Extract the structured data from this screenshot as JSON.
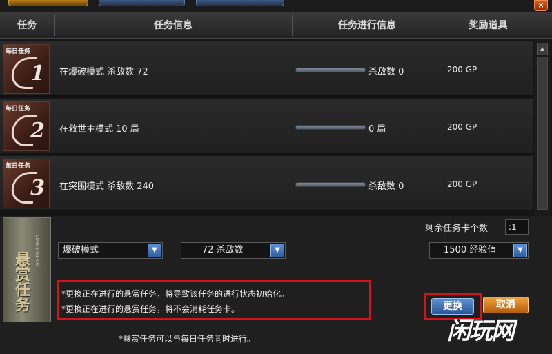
{
  "window": {
    "close_label": "×"
  },
  "header": {
    "col_task": "任务",
    "col_info": "任务信息",
    "col_progress": "任务进行信息",
    "col_reward": "奖励道具"
  },
  "daily": {
    "badge_label": "每日任务",
    "tasks": [
      {
        "num": "1",
        "info": "在爆破模式 杀敌数 72",
        "progress": "杀敌数 0",
        "reward": "200 GP",
        "progress_fraction": 0
      },
      {
        "num": "2",
        "info": "在救世主模式 10 局",
        "progress": "0 局",
        "reward": "200 GP",
        "progress_fraction": 0
      },
      {
        "num": "3",
        "info": "在突围模式 杀敌数 240",
        "progress": "杀敌数 0",
        "reward": "200 GP",
        "progress_fraction": 0
      }
    ]
  },
  "scrollbar": {
    "up_icon": "▲"
  },
  "bounty": {
    "card_title": "悬赏任务",
    "card_code": "00001-01-00",
    "mode_select": "爆破模式",
    "kills_select": "72 杀敌数",
    "card_count_label": "剩余任务卡个数",
    "card_count_value": ":1",
    "reward_select": "1500 经验值",
    "note_1": "*更换正在进行的悬赏任务，将导致该任务的进行状态初始化。",
    "note_2": "*更换正在进行的悬赏任务，将不会消耗任务卡。",
    "replace_button": "更换",
    "cancel_button": "取消",
    "footnote": "*悬赏任务可以与每日任务同时进行。",
    "arrow_icon": "▼"
  },
  "watermark": "闲玩网",
  "colors": {
    "highlight_red": "#d4141a",
    "button_blue": "#2a5698",
    "button_orange": "#b35e0b"
  }
}
